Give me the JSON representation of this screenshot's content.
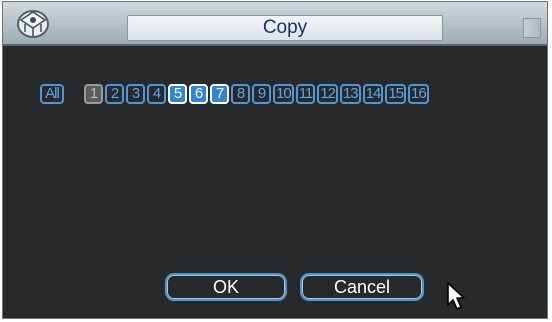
{
  "window": {
    "title": "Copy",
    "logo_icon": "camera-logo-icon"
  },
  "channels": {
    "all_label": "All",
    "items": [
      {
        "label": "1",
        "state": "disabled"
      },
      {
        "label": "2",
        "state": "unchecked"
      },
      {
        "label": "3",
        "state": "unchecked"
      },
      {
        "label": "4",
        "state": "unchecked"
      },
      {
        "label": "5",
        "state": "checked"
      },
      {
        "label": "6",
        "state": "checked"
      },
      {
        "label": "7",
        "state": "checked"
      },
      {
        "label": "8",
        "state": "unchecked"
      },
      {
        "label": "9",
        "state": "unchecked"
      },
      {
        "label": "10",
        "state": "unchecked"
      },
      {
        "label": "11",
        "state": "unchecked"
      },
      {
        "label": "12",
        "state": "unchecked"
      },
      {
        "label": "13",
        "state": "unchecked"
      },
      {
        "label": "14",
        "state": "unchecked"
      },
      {
        "label": "15",
        "state": "unchecked"
      },
      {
        "label": "16",
        "state": "unchecked"
      }
    ]
  },
  "buttons": {
    "ok_label": "OK",
    "cancel_label": "Cancel"
  },
  "colors": {
    "background": "#27292a",
    "accent": "#4f97d8",
    "title_text": "#1a2e7a"
  }
}
